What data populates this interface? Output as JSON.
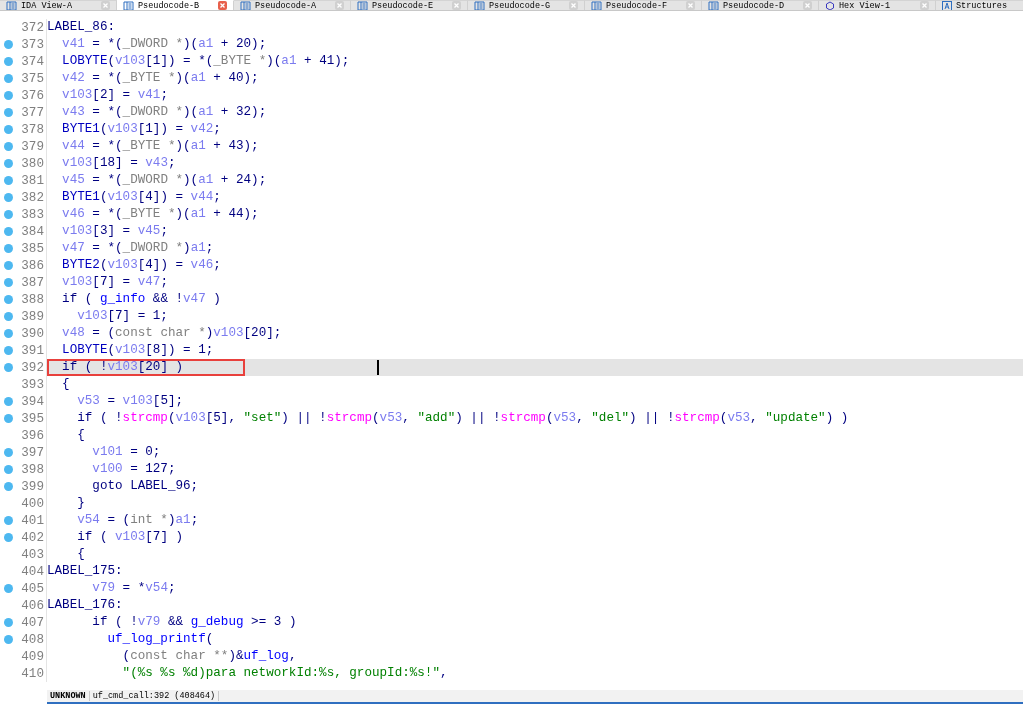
{
  "tabs": [
    {
      "label": "IDA View-A",
      "kind": "disasm",
      "selected": false
    },
    {
      "label": "Pseudocode-B",
      "kind": "pseudo",
      "selected": true
    },
    {
      "label": "Pseudocode-A",
      "kind": "pseudo",
      "selected": false
    },
    {
      "label": "Pseudocode-E",
      "kind": "pseudo",
      "selected": false
    },
    {
      "label": "Pseudocode-G",
      "kind": "pseudo",
      "selected": false
    },
    {
      "label": "Pseudocode-F",
      "kind": "pseudo",
      "selected": false
    },
    {
      "label": "Pseudocode-D",
      "kind": "pseudo",
      "selected": false
    },
    {
      "label": "Hex View-1",
      "kind": "hex",
      "selected": false
    },
    {
      "label": "Structures",
      "kind": "struct",
      "selected": false
    }
  ],
  "lines": [
    {
      "number": "372",
      "breakpoint": false,
      "tokens": [
        {
          "kind": "plain",
          "text": "LABEL_86:"
        }
      ]
    },
    {
      "number": "373",
      "breakpoint": true,
      "tokens": [
        {
          "kind": "var",
          "text": "  v41"
        },
        {
          "kind": "plain",
          "text": " = *("
        },
        {
          "kind": "type",
          "text": "_DWORD *"
        },
        {
          "kind": "plain",
          "text": ")("
        },
        {
          "kind": "var",
          "text": "a1"
        },
        {
          "kind": "plain",
          "text": " + 20);"
        }
      ]
    },
    {
      "number": "374",
      "breakpoint": true,
      "tokens": [
        {
          "kind": "macro",
          "text": "  LOBYTE"
        },
        {
          "kind": "plain",
          "text": "("
        },
        {
          "kind": "var",
          "text": "v103"
        },
        {
          "kind": "plain",
          "text": "[1]) = *("
        },
        {
          "kind": "type",
          "text": "_BYTE *"
        },
        {
          "kind": "plain",
          "text": ")("
        },
        {
          "kind": "var",
          "text": "a1"
        },
        {
          "kind": "plain",
          "text": " + 41);"
        }
      ]
    },
    {
      "number": "375",
      "breakpoint": true,
      "tokens": [
        {
          "kind": "var",
          "text": "  v42"
        },
        {
          "kind": "plain",
          "text": " = *("
        },
        {
          "kind": "type",
          "text": "_BYTE *"
        },
        {
          "kind": "plain",
          "text": ")("
        },
        {
          "kind": "var",
          "text": "a1"
        },
        {
          "kind": "plain",
          "text": " + 40);"
        }
      ]
    },
    {
      "number": "376",
      "breakpoint": true,
      "tokens": [
        {
          "kind": "var",
          "text": "  v103"
        },
        {
          "kind": "plain",
          "text": "[2] = "
        },
        {
          "kind": "var",
          "text": "v41"
        },
        {
          "kind": "plain",
          "text": ";"
        }
      ]
    },
    {
      "number": "377",
      "breakpoint": true,
      "tokens": [
        {
          "kind": "var",
          "text": "  v43"
        },
        {
          "kind": "plain",
          "text": " = *("
        },
        {
          "kind": "type",
          "text": "_DWORD *"
        },
        {
          "kind": "plain",
          "text": ")("
        },
        {
          "kind": "var",
          "text": "a1"
        },
        {
          "kind": "plain",
          "text": " + 32);"
        }
      ]
    },
    {
      "number": "378",
      "breakpoint": true,
      "tokens": [
        {
          "kind": "macro",
          "text": "  BYTE1"
        },
        {
          "kind": "plain",
          "text": "("
        },
        {
          "kind": "var",
          "text": "v103"
        },
        {
          "kind": "plain",
          "text": "[1]) = "
        },
        {
          "kind": "var",
          "text": "v42"
        },
        {
          "kind": "plain",
          "text": ";"
        }
      ]
    },
    {
      "number": "379",
      "breakpoint": true,
      "tokens": [
        {
          "kind": "var",
          "text": "  v44"
        },
        {
          "kind": "plain",
          "text": " = *("
        },
        {
          "kind": "type",
          "text": "_BYTE *"
        },
        {
          "kind": "plain",
          "text": ")("
        },
        {
          "kind": "var",
          "text": "a1"
        },
        {
          "kind": "plain",
          "text": " + 43);"
        }
      ]
    },
    {
      "number": "380",
      "breakpoint": true,
      "tokens": [
        {
          "kind": "var",
          "text": "  v103"
        },
        {
          "kind": "plain",
          "text": "[18] = "
        },
        {
          "kind": "var",
          "text": "v43"
        },
        {
          "kind": "plain",
          "text": ";"
        }
      ]
    },
    {
      "number": "381",
      "breakpoint": true,
      "tokens": [
        {
          "kind": "var",
          "text": "  v45"
        },
        {
          "kind": "plain",
          "text": " = *("
        },
        {
          "kind": "type",
          "text": "_DWORD *"
        },
        {
          "kind": "plain",
          "text": ")("
        },
        {
          "kind": "var",
          "text": "a1"
        },
        {
          "kind": "plain",
          "text": " + 24);"
        }
      ]
    },
    {
      "number": "382",
      "breakpoint": true,
      "tokens": [
        {
          "kind": "macro",
          "text": "  BYTE1"
        },
        {
          "kind": "plain",
          "text": "("
        },
        {
          "kind": "var",
          "text": "v103"
        },
        {
          "kind": "plain",
          "text": "[4]) = "
        },
        {
          "kind": "var",
          "text": "v44"
        },
        {
          "kind": "plain",
          "text": ";"
        }
      ]
    },
    {
      "number": "383",
      "breakpoint": true,
      "tokens": [
        {
          "kind": "var",
          "text": "  v46"
        },
        {
          "kind": "plain",
          "text": " = *("
        },
        {
          "kind": "type",
          "text": "_BYTE *"
        },
        {
          "kind": "plain",
          "text": ")("
        },
        {
          "kind": "var",
          "text": "a1"
        },
        {
          "kind": "plain",
          "text": " + 44);"
        }
      ]
    },
    {
      "number": "384",
      "breakpoint": true,
      "tokens": [
        {
          "kind": "var",
          "text": "  v103"
        },
        {
          "kind": "plain",
          "text": "[3] = "
        },
        {
          "kind": "var",
          "text": "v45"
        },
        {
          "kind": "plain",
          "text": ";"
        }
      ]
    },
    {
      "number": "385",
      "breakpoint": true,
      "tokens": [
        {
          "kind": "var",
          "text": "  v47"
        },
        {
          "kind": "plain",
          "text": " = *("
        },
        {
          "kind": "type",
          "text": "_DWORD *"
        },
        {
          "kind": "plain",
          "text": ")"
        },
        {
          "kind": "var",
          "text": "a1"
        },
        {
          "kind": "plain",
          "text": ";"
        }
      ]
    },
    {
      "number": "386",
      "breakpoint": true,
      "tokens": [
        {
          "kind": "macro",
          "text": "  BYTE2"
        },
        {
          "kind": "plain",
          "text": "("
        },
        {
          "kind": "var",
          "text": "v103"
        },
        {
          "kind": "plain",
          "text": "[4]) = "
        },
        {
          "kind": "var",
          "text": "v46"
        },
        {
          "kind": "plain",
          "text": ";"
        }
      ]
    },
    {
      "number": "387",
      "breakpoint": true,
      "tokens": [
        {
          "kind": "var",
          "text": "  v103"
        },
        {
          "kind": "plain",
          "text": "[7] = "
        },
        {
          "kind": "var",
          "text": "v47"
        },
        {
          "kind": "plain",
          "text": ";"
        }
      ]
    },
    {
      "number": "388",
      "breakpoint": true,
      "tokens": [
        {
          "kind": "plain",
          "text": "  if ( "
        },
        {
          "kind": "global",
          "text": "g_info"
        },
        {
          "kind": "plain",
          "text": " && !"
        },
        {
          "kind": "var",
          "text": "v47"
        },
        {
          "kind": "plain",
          "text": " )"
        }
      ]
    },
    {
      "number": "389",
      "breakpoint": true,
      "tokens": [
        {
          "kind": "var",
          "text": "    v103"
        },
        {
          "kind": "plain",
          "text": "[7] = 1;"
        }
      ]
    },
    {
      "number": "390",
      "breakpoint": true,
      "tokens": [
        {
          "kind": "var",
          "text": "  v48"
        },
        {
          "kind": "plain",
          "text": " = ("
        },
        {
          "kind": "type",
          "text": "const char *"
        },
        {
          "kind": "plain",
          "text": ")"
        },
        {
          "kind": "var",
          "text": "v103"
        },
        {
          "kind": "plain",
          "text": "[20];"
        }
      ]
    },
    {
      "number": "391",
      "breakpoint": true,
      "tokens": [
        {
          "kind": "macro",
          "text": "  LOBYTE"
        },
        {
          "kind": "plain",
          "text": "("
        },
        {
          "kind": "var",
          "text": "v103"
        },
        {
          "kind": "plain",
          "text": "[8]) = 1;"
        }
      ]
    },
    {
      "number": "392",
      "breakpoint": true,
      "current": true,
      "boxed": true,
      "tokens": [
        {
          "kind": "plain",
          "text": "  if ( !"
        },
        {
          "kind": "var",
          "text": "v103"
        },
        {
          "kind": "plain",
          "text": "[20] )"
        }
      ]
    },
    {
      "number": "393",
      "breakpoint": false,
      "tokens": [
        {
          "kind": "plain",
          "text": "  {"
        }
      ]
    },
    {
      "number": "394",
      "breakpoint": true,
      "tokens": [
        {
          "kind": "var",
          "text": "    v53"
        },
        {
          "kind": "plain",
          "text": " = "
        },
        {
          "kind": "var",
          "text": "v103"
        },
        {
          "kind": "plain",
          "text": "[5];"
        }
      ]
    },
    {
      "number": "395",
      "breakpoint": true,
      "tokens": [
        {
          "kind": "plain",
          "text": "    if ( !"
        },
        {
          "kind": "func",
          "text": "strcmp"
        },
        {
          "kind": "plain",
          "text": "("
        },
        {
          "kind": "var",
          "text": "v103"
        },
        {
          "kind": "plain",
          "text": "[5], "
        },
        {
          "kind": "string",
          "text": "\"set\""
        },
        {
          "kind": "plain",
          "text": ") || !"
        },
        {
          "kind": "func",
          "text": "strcmp"
        },
        {
          "kind": "plain",
          "text": "("
        },
        {
          "kind": "var",
          "text": "v53"
        },
        {
          "kind": "plain",
          "text": ", "
        },
        {
          "kind": "string",
          "text": "\"add\""
        },
        {
          "kind": "plain",
          "text": ") || !"
        },
        {
          "kind": "func",
          "text": "strcmp"
        },
        {
          "kind": "plain",
          "text": "("
        },
        {
          "kind": "var",
          "text": "v53"
        },
        {
          "kind": "plain",
          "text": ", "
        },
        {
          "kind": "string",
          "text": "\"del\""
        },
        {
          "kind": "plain",
          "text": ") || !"
        },
        {
          "kind": "func",
          "text": "strcmp"
        },
        {
          "kind": "plain",
          "text": "("
        },
        {
          "kind": "var",
          "text": "v53"
        },
        {
          "kind": "plain",
          "text": ", "
        },
        {
          "kind": "string",
          "text": "\"update\""
        },
        {
          "kind": "plain",
          "text": ") )"
        }
      ]
    },
    {
      "number": "396",
      "breakpoint": false,
      "tokens": [
        {
          "kind": "plain",
          "text": "    {"
        }
      ]
    },
    {
      "number": "397",
      "breakpoint": true,
      "tokens": [
        {
          "kind": "var",
          "text": "      v101"
        },
        {
          "kind": "plain",
          "text": " = 0;"
        }
      ]
    },
    {
      "number": "398",
      "breakpoint": true,
      "tokens": [
        {
          "kind": "var",
          "text": "      v100"
        },
        {
          "kind": "plain",
          "text": " = 127;"
        }
      ]
    },
    {
      "number": "399",
      "breakpoint": true,
      "tokens": [
        {
          "kind": "plain",
          "text": "      goto LABEL_96;"
        }
      ]
    },
    {
      "number": "400",
      "breakpoint": false,
      "tokens": [
        {
          "kind": "plain",
          "text": "    }"
        }
      ]
    },
    {
      "number": "401",
      "breakpoint": true,
      "tokens": [
        {
          "kind": "var",
          "text": "    v54"
        },
        {
          "kind": "plain",
          "text": " = ("
        },
        {
          "kind": "type",
          "text": "int *"
        },
        {
          "kind": "plain",
          "text": ")"
        },
        {
          "kind": "var",
          "text": "a1"
        },
        {
          "kind": "plain",
          "text": ";"
        }
      ]
    },
    {
      "number": "402",
      "breakpoint": true,
      "tokens": [
        {
          "kind": "plain",
          "text": "    if ( "
        },
        {
          "kind": "var",
          "text": "v103"
        },
        {
          "kind": "plain",
          "text": "[7] )"
        }
      ]
    },
    {
      "number": "403",
      "breakpoint": false,
      "tokens": [
        {
          "kind": "plain",
          "text": "    {"
        }
      ]
    },
    {
      "number": "404",
      "breakpoint": false,
      "tokens": [
        {
          "kind": "plain",
          "text": "LABEL_175:"
        }
      ]
    },
    {
      "number": "405",
      "breakpoint": true,
      "tokens": [
        {
          "kind": "var",
          "text": "      v79"
        },
        {
          "kind": "plain",
          "text": " = *"
        },
        {
          "kind": "var",
          "text": "v54"
        },
        {
          "kind": "plain",
          "text": ";"
        }
      ]
    },
    {
      "number": "406",
      "breakpoint": false,
      "tokens": [
        {
          "kind": "plain",
          "text": "LABEL_176:"
        }
      ]
    },
    {
      "number": "407",
      "breakpoint": true,
      "tokens": [
        {
          "kind": "plain",
          "text": "      if ( !"
        },
        {
          "kind": "var",
          "text": "v79"
        },
        {
          "kind": "plain",
          "text": " && "
        },
        {
          "kind": "global",
          "text": "g_debug"
        },
        {
          "kind": "plain",
          "text": " >= 3 )"
        }
      ]
    },
    {
      "number": "408",
      "breakpoint": true,
      "tokens": [
        {
          "kind": "global",
          "text": "        uf_log_printf"
        },
        {
          "kind": "plain",
          "text": "("
        }
      ]
    },
    {
      "number": "409",
      "breakpoint": false,
      "tokens": [
        {
          "kind": "plain",
          "text": "          ("
        },
        {
          "kind": "type",
          "text": "const char **"
        },
        {
          "kind": "plain",
          "text": ")&"
        },
        {
          "kind": "global",
          "text": "uf_log"
        },
        {
          "kind": "plain",
          "text": ","
        }
      ]
    },
    {
      "number": "410",
      "breakpoint": false,
      "tokens": [
        {
          "kind": "string",
          "text": "          \"(%s %s %d)para networkId:%s, groupId:%s!\""
        },
        {
          "kind": "plain",
          "text": ","
        }
      ]
    }
  ],
  "status_bar": {
    "mode": "UNKNOWN",
    "location": "uf_cmd_call:392 (408464)"
  }
}
